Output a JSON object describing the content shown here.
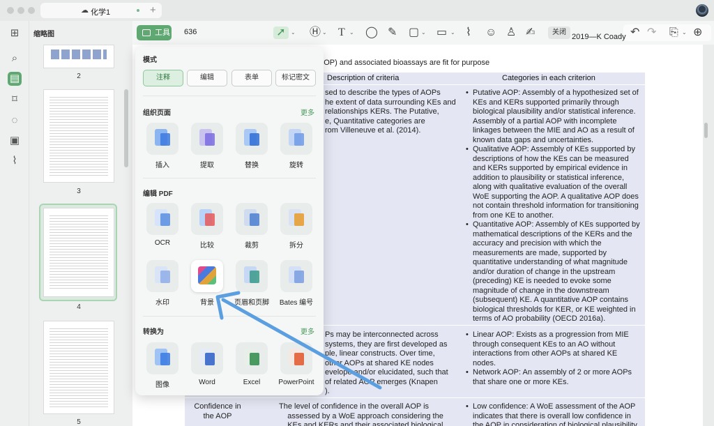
{
  "tab": {
    "title": "化学1"
  },
  "sidebar": {
    "title": "缩略图",
    "pages": [
      "2",
      "3",
      "4",
      "5"
    ]
  },
  "toolbar": {
    "tools_label": "工具",
    "page_number": "636",
    "close_label": "关闭",
    "doc_header_text": "2019—K Coady"
  },
  "document": {
    "heading": "whether an Adverse Outcome Pathway (AOP) and associated bioassays are fit for purpose",
    "col_headers": [
      "Description of criteria",
      "Categories in each criterion"
    ],
    "row1_desc": "sed to describe the types of AOPs\nhe extent of data surrounding KEs and\nrelationships KERs. The Putative,\ne, Quantitative categories are\nrom Villeneuve et al. (2014).",
    "row1_items": [
      "Putative AOP: Assembly of a hypothesized set of KEs and KERs supported primarily through biological plausibility and/or statistical inference. Assembly of a partial AOP with incomplete linkages between the MIE and AO as a result of known data gaps and uncertainties.",
      "Qualitative AOP: Assembly of KEs supported by descriptions of how the KEs can be measured and KERs supported by empirical evidence in addition to plausibility or statistical inference, along with qualitative evaluation of the overall WoE supporting the AOP. A qualitative AOP does not contain threshold information for transitioning from one KE to another.",
      "Quantitative AOP: Assembly of KEs supported by mathematical descriptions of the KERs and the accuracy and precision with which the measurements are made, supported by quantitative understanding of what magnitude and/or duration of change in the upstream (preceding) KE is needed to evoke some magnitude of change in the downstream (subsequent) KE. A quantitative AOP contains biological thresholds for KER, or KE weighted in terms of AO probability (OECD 2016a)."
    ],
    "row2_desc": "Ps may be interconnected across\nsystems, they are first developed as\nple, linear constructs. Over time,\n other AOPs at shared KE nodes\nevelope and/or elucidated, such that\nof related AOP emerges (Knapen\n).",
    "row2_items": [
      "Linear AOP: Exists as a progression from MIE through consequent KEs to an AO without interactions from other AOPs at shared KE nodes.",
      "Network AOP: An assembly of 2 or more AOPs that share one or more KEs."
    ],
    "row3_label": "Confidence in\nthe AOP",
    "row3_desc": "The level of confidence in the overall AOP is\n    assessed by a WoE approach considering the\n    KEs and KERs and their associated biological",
    "row3_items": [
      "Low confidence: A WoE assessment of the AOP indicates that there is overall low confidence in the AOP in consideration of biological plausibility"
    ]
  },
  "panel": {
    "mode_title": "模式",
    "modes": [
      "注释",
      "编辑",
      "表单",
      "标记密文"
    ],
    "section1_title": "组织页面",
    "section1_more": "更多",
    "section1_tools": [
      "插入",
      "提取",
      "替换",
      "旋转"
    ],
    "section2_title": "编辑 PDF",
    "section2_tools": [
      "OCR",
      "比较",
      "裁剪",
      "拆分"
    ],
    "section2b_tools": [
      "水印",
      "背景",
      "页眉和页脚",
      "Bates 编号"
    ],
    "section3_title": "转换为",
    "section3_more": "更多",
    "section3_tools": [
      "图像",
      "Word",
      "Excel",
      "PowerPoint"
    ]
  },
  "colors": {
    "accent": "#5fa872",
    "arrow": "#5b9fe0",
    "table_bg": "#e4e7f3"
  }
}
